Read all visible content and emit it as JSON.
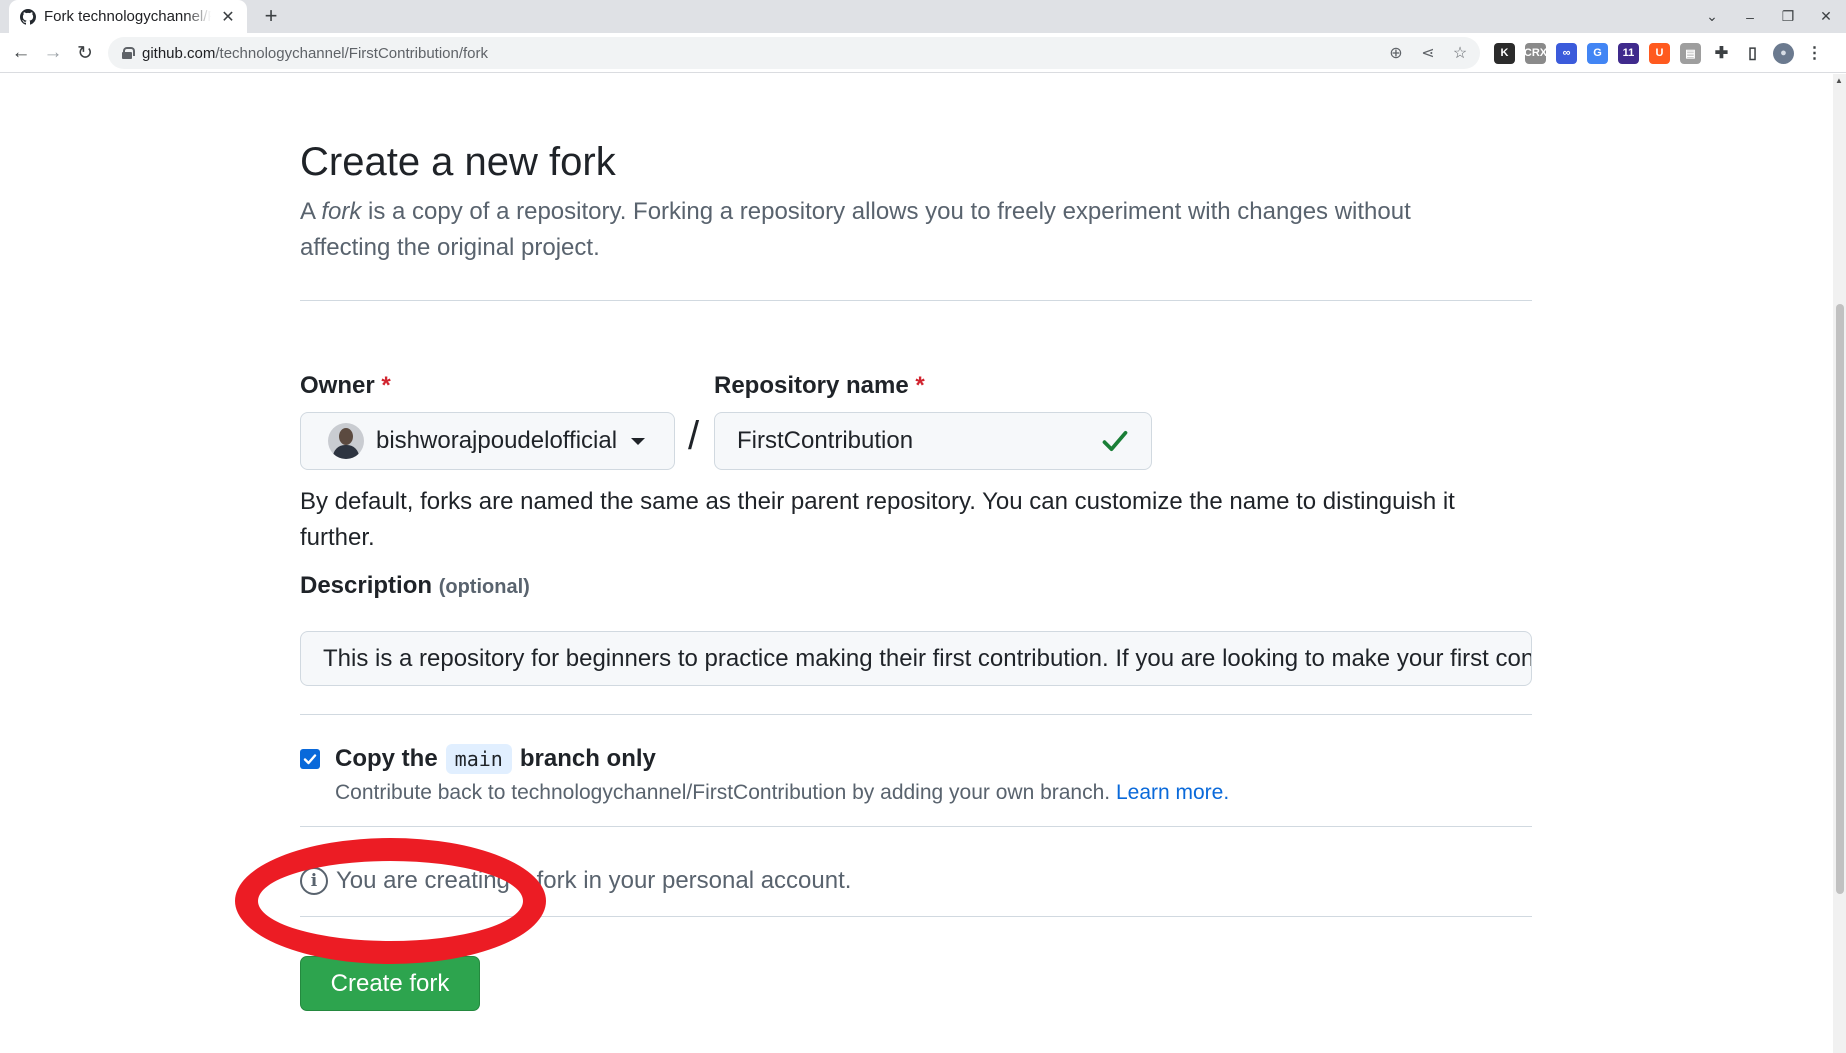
{
  "browser": {
    "tab_title": "Fork technologychannel/FirstContribution",
    "tab_close": "✕",
    "new_tab": "+",
    "url_host": "github.com",
    "url_path": "/technologychannel/FirstContribution/fork",
    "win_controls": {
      "tabs": "⌄",
      "minimize": "–",
      "restore": "❐",
      "close": "✕"
    },
    "nav": {
      "back": "←",
      "forward": "→",
      "reload": "↻"
    },
    "omni_icons": {
      "zoom": "⊕",
      "share": "⋖",
      "bookmark": "☆"
    },
    "extensions": [
      {
        "name": "k-extension-icon",
        "label": "K",
        "color": "#2b2b2b"
      },
      {
        "name": "crx-extension-icon",
        "label": "CRX",
        "color": "#8a8a8a"
      },
      {
        "name": "link-extension-icon",
        "label": "∞",
        "color": "#3b5bdb"
      },
      {
        "name": "translate-extension-icon",
        "label": "G",
        "color": "#4285f4"
      },
      {
        "name": "graduation-extension-icon",
        "label": "11",
        "color": "#3f2a8c"
      },
      {
        "name": "u-extension-icon",
        "label": "U",
        "color": "#ff5a1f"
      },
      {
        "name": "reader-extension-icon",
        "label": "▤",
        "color": "#9e9e9e"
      },
      {
        "name": "puzzle-extension-icon",
        "label": "✚",
        "color": "#3c4043"
      },
      {
        "name": "sidepanel-icon",
        "label": "▯",
        "color": "#3c4043"
      },
      {
        "name": "profile-avatar-icon",
        "label": "●",
        "color": "#6b7a8f"
      },
      {
        "name": "menu-kebab-icon",
        "label": "⋮",
        "color": "#3c4043"
      }
    ]
  },
  "page": {
    "heading": "Create a new fork",
    "subtitle_a": "A ",
    "subtitle_em": "fork",
    "subtitle_b": " is a copy of a repository. Forking a repository allows you to freely experiment with changes without affecting the original project.",
    "owner_label": "Owner",
    "required_mark": "*",
    "owner_value": "bishworajpoudelofficial",
    "slash": "/",
    "repo_label": "Repository name",
    "repo_value": "FirstContribution",
    "hint": "By default, forks are named the same as their parent repository. You can customize the name to distinguish it further.",
    "description_label": "Description",
    "description_optional": "(optional)",
    "description_value": "This is a repository for beginners to practice making their first contribution. If you are looking to make your first contribution, follow the steps below.",
    "copy_label_a": "Copy the",
    "copy_code": "main",
    "copy_label_b": "branch only",
    "copy_checked": true,
    "copy_note": "Contribute back to technologychannel/FirstContribution by adding your own branch.",
    "learn_more": "Learn more.",
    "info_text": "You are creating a fork in your personal account.",
    "info_glyph": "i",
    "create_button": "Create fork"
  },
  "colors": {
    "primary_button": "#2da44e",
    "link": "#0969da",
    "checkbox": "#0969da",
    "annotation": "#ec1c24",
    "valid_check": "#1a7f37"
  }
}
